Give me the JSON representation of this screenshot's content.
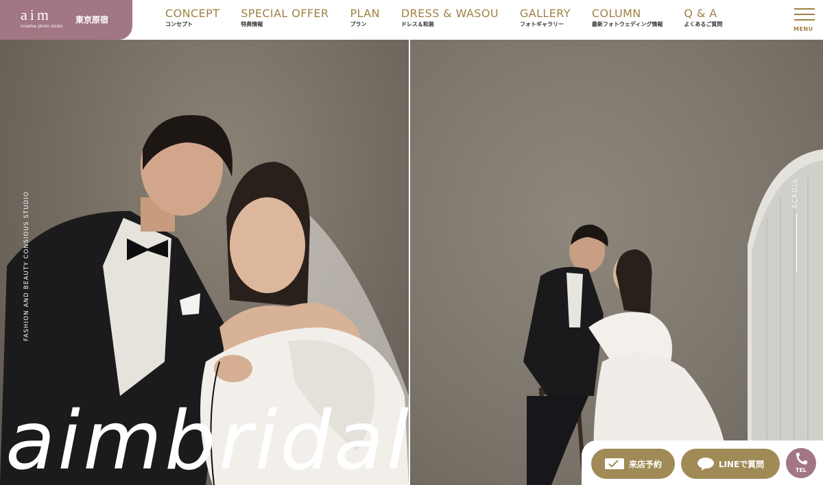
{
  "header": {
    "logo": {
      "mark": "aim",
      "sub": "creative photo studio",
      "place": "東京原宿"
    },
    "nav": [
      {
        "en": "CONCEPT",
        "jp": "コンセプト"
      },
      {
        "en": "SPECIAL OFFER",
        "jp": "特典情報"
      },
      {
        "en": "PLAN",
        "jp": "プラン"
      },
      {
        "en": "DRESS & WASOU",
        "jp": "ドレス＆和装"
      },
      {
        "en": "GALLERY",
        "jp": "フォトギャラリー"
      },
      {
        "en": "COLUMN",
        "jp": "最新フォトウェディング情報"
      },
      {
        "en": "Q & A",
        "jp": "よくあるご質問"
      }
    ],
    "menu_label": "MENU"
  },
  "hero": {
    "side_caption": "FASHION AND BEAUTY CONSIOUS STUDIO",
    "scroll_label": "SCROLL",
    "brand_text": "aimbridal"
  },
  "cta": {
    "visit_label": "来店予約",
    "line_label": "LINEで質問",
    "tel_label": "TEL"
  },
  "colors": {
    "logo_bg": "#a37684",
    "nav_text": "#9e8244",
    "cta_gold": "#a08a56",
    "tel_pink": "#a37684"
  }
}
